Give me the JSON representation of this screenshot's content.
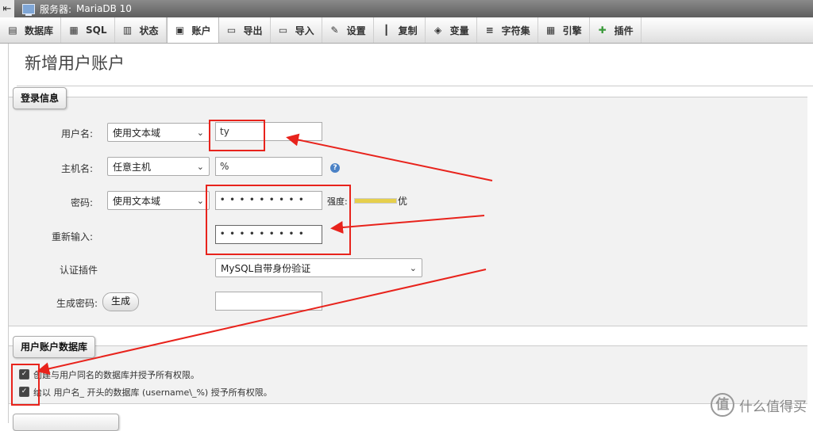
{
  "topbar": {
    "back_glyph": "⇤",
    "server_label": "服务器:",
    "server_name": "MariaDB 10"
  },
  "tabs": [
    {
      "label": "数据库",
      "icon": "database-icon",
      "glyph": "▤"
    },
    {
      "label": "SQL",
      "icon": "sql-icon",
      "glyph": "▦"
    },
    {
      "label": "状态",
      "icon": "status-icon",
      "glyph": "▥"
    },
    {
      "label": "账户",
      "icon": "accounts-icon",
      "glyph": "▣",
      "active": true
    },
    {
      "label": "导出",
      "icon": "export-icon",
      "glyph": "▭"
    },
    {
      "label": "导入",
      "icon": "import-icon",
      "glyph": "▭"
    },
    {
      "label": "设置",
      "icon": "settings-icon",
      "glyph": "✎"
    },
    {
      "label": "复制",
      "icon": "replication-icon",
      "glyph": "┃"
    },
    {
      "label": "变量",
      "icon": "variables-icon",
      "glyph": "◈"
    },
    {
      "label": "字符集",
      "icon": "charset-icon",
      "glyph": "≡"
    },
    {
      "label": "引擎",
      "icon": "engine-icon",
      "glyph": "▦"
    },
    {
      "label": "插件",
      "icon": "plugin-icon",
      "glyph": "✚"
    }
  ],
  "page": {
    "title": "新增用户账户"
  },
  "login": {
    "legend": "登录信息",
    "username": {
      "label": "用户名:",
      "mode": "使用文本域",
      "value": "ty"
    },
    "host": {
      "label": "主机名:",
      "mode": "任意主机",
      "value": "%"
    },
    "password": {
      "label": "密码:",
      "mode": "使用文本域",
      "value": "•••••••••",
      "strength_label": "强度:",
      "strength_value": "优",
      "strength_level": 1.0
    },
    "retype": {
      "label": "重新输入:",
      "value": "•••••••••"
    },
    "auth_plugin": {
      "label": "认证插件",
      "value": "MySQL自带身份验证"
    },
    "generate": {
      "label": "生成密码:",
      "button": "生成",
      "value": ""
    }
  },
  "database": {
    "legend": "用户账户数据库",
    "options": [
      {
        "label": "创建与用户同名的数据库并授予所有权限。",
        "checked": true
      },
      {
        "label": "给以 用户名_ 开头的数据库 (username\\_%) 授予所有权限。",
        "checked": true
      }
    ]
  },
  "watermark": {
    "glyph": "值",
    "text": "什么值得买"
  },
  "colors": {
    "annotation": "#e8231c",
    "strength_fill": "#e6cf4c",
    "help": "#4b82c6"
  }
}
